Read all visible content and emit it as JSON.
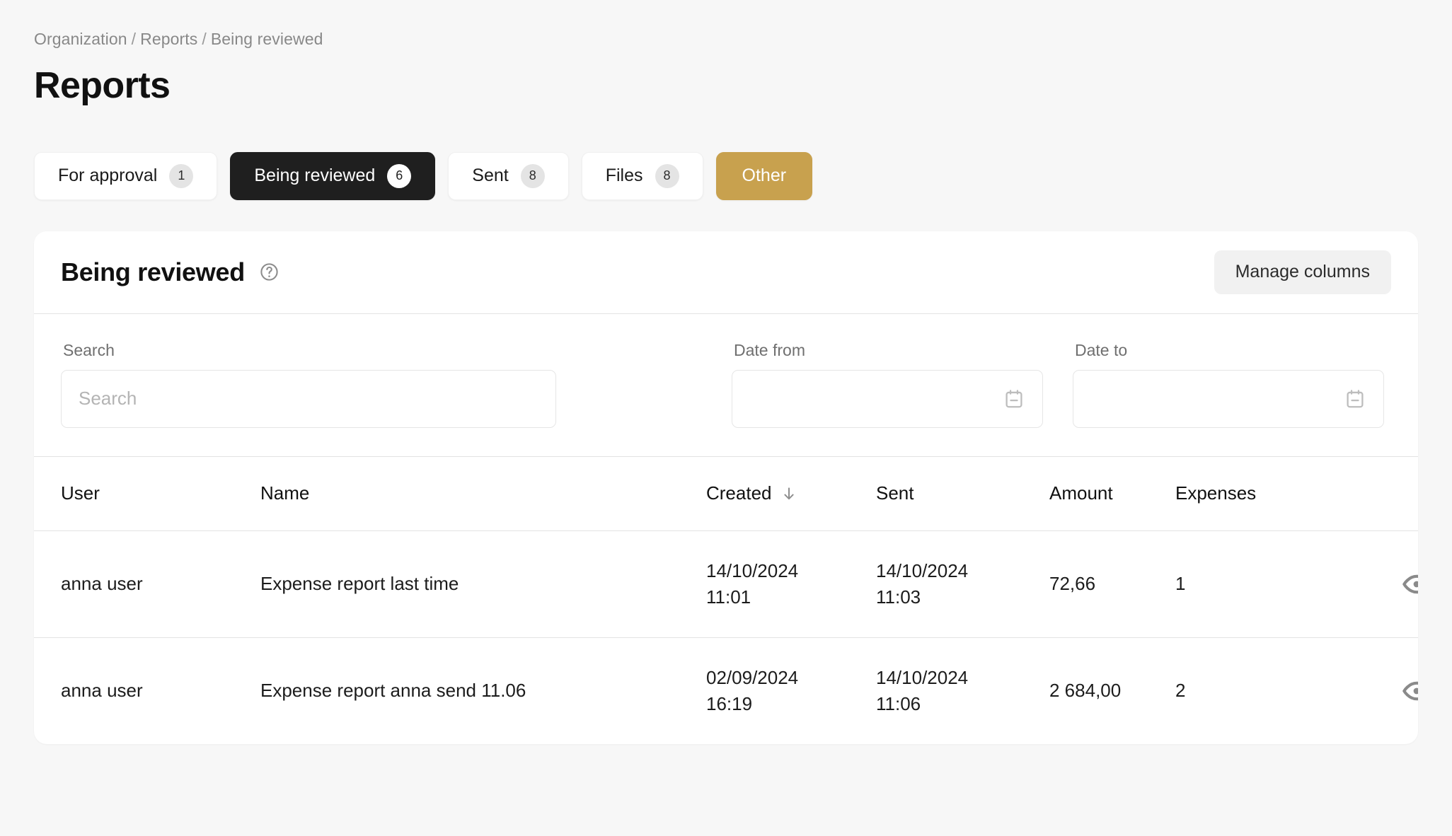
{
  "breadcrumb": {
    "items": [
      "Organization",
      "Reports",
      "Being reviewed"
    ],
    "separator": "/"
  },
  "page": {
    "title": "Reports"
  },
  "tabs": [
    {
      "label": "For approval",
      "badge": "1",
      "state": "default"
    },
    {
      "label": "Being reviewed",
      "badge": "6",
      "state": "active"
    },
    {
      "label": "Sent",
      "badge": "8",
      "state": "default"
    },
    {
      "label": "Files",
      "badge": "8",
      "state": "default"
    },
    {
      "label": "Other",
      "badge": "",
      "state": "accent"
    }
  ],
  "card": {
    "title": "Being reviewed",
    "help_icon": "question-circle-icon",
    "manage_columns_label": "Manage columns"
  },
  "filters": {
    "search": {
      "label": "Search",
      "placeholder": "Search",
      "value": ""
    },
    "date_from": {
      "label": "Date from",
      "placeholder": "",
      "value": "",
      "icon": "calendar-icon"
    },
    "date_to": {
      "label": "Date to",
      "placeholder": "",
      "value": "",
      "icon": "calendar-icon"
    }
  },
  "table": {
    "columns": [
      {
        "key": "user",
        "label": "User"
      },
      {
        "key": "name",
        "label": "Name"
      },
      {
        "key": "created",
        "label": "Created",
        "sort": "desc",
        "sort_icon": "arrow-down-icon"
      },
      {
        "key": "sent",
        "label": "Sent"
      },
      {
        "key": "amount",
        "label": "Amount"
      },
      {
        "key": "expenses",
        "label": "Expenses"
      }
    ],
    "rows": [
      {
        "user": "anna user",
        "name": "Expense report last time",
        "created_date": "14/10/2024",
        "created_time": "11:01",
        "sent_date": "14/10/2024",
        "sent_time": "11:03",
        "amount": "72,66",
        "expenses": "1",
        "view_icon": "eye-icon",
        "menu_icon": "kebab-menu-icon"
      },
      {
        "user": "anna user",
        "name": "Expense report anna send 11.06",
        "created_date": "02/09/2024",
        "created_time": "16:19",
        "sent_date": "14/10/2024",
        "sent_time": "11:06",
        "amount": "2 684,00",
        "expenses": "2",
        "view_icon": "eye-icon",
        "menu_icon": "kebab-menu-icon"
      }
    ]
  },
  "colors": {
    "page_background": "#f7f7f7",
    "card_background": "#ffffff",
    "active_tab": "#1f1f1f",
    "accent_tab": "#c8a14e",
    "badge_default": "#e4e4e4",
    "divider": "#e3e3e3",
    "muted_text": "#888888"
  }
}
